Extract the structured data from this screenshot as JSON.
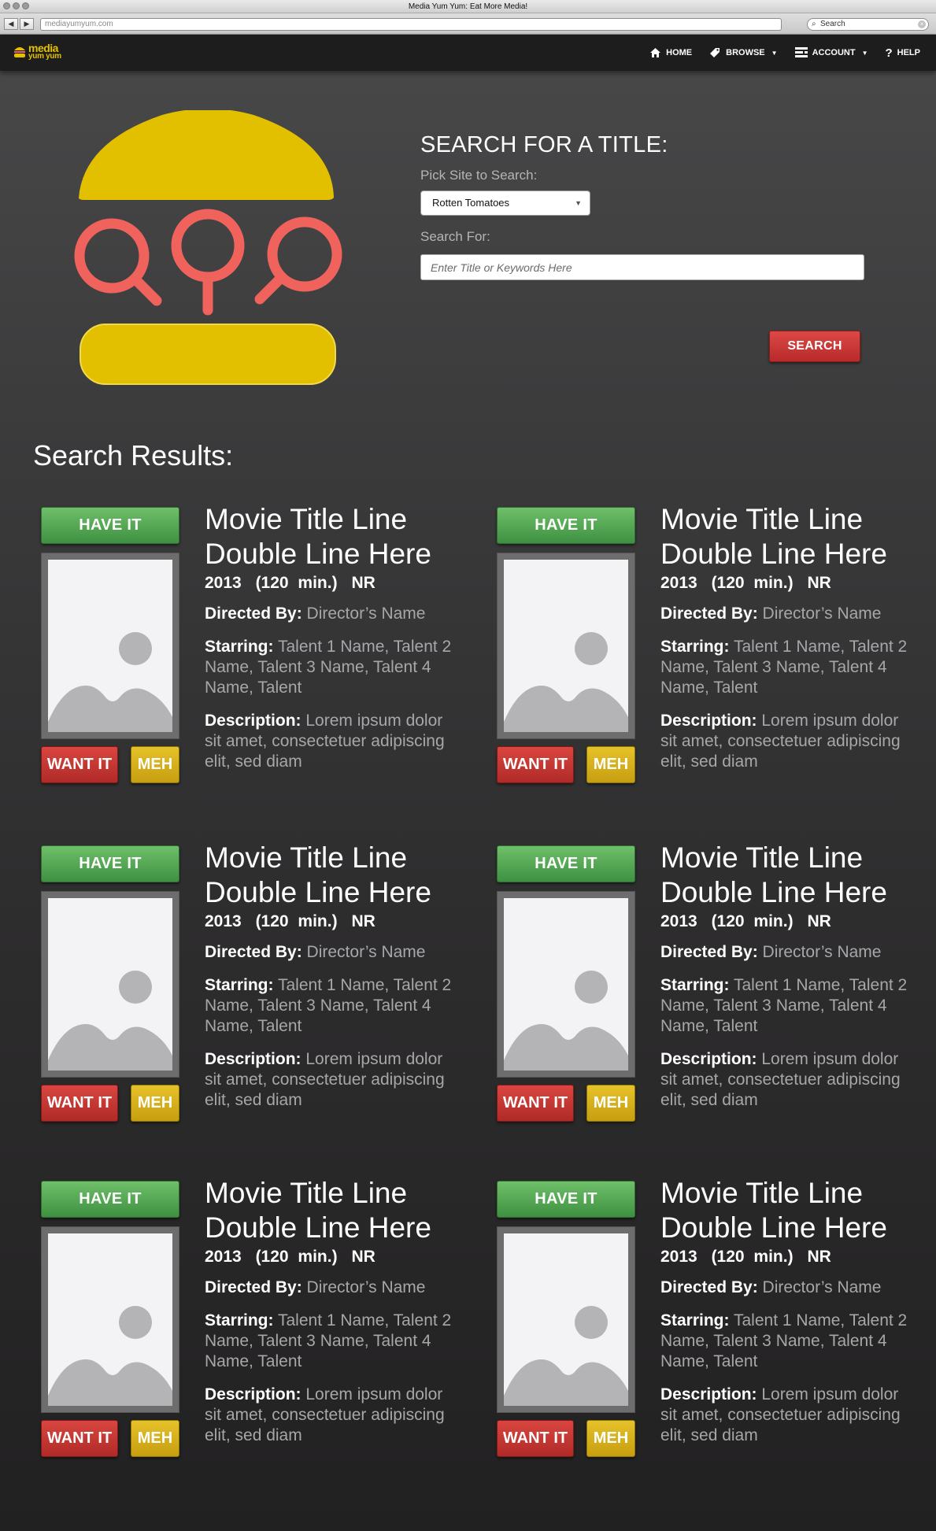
{
  "browser": {
    "window_title": "Media Yum Yum: Eat More Media!",
    "url": "mediayumyum.com",
    "search_placeholder": "Search",
    "back_glyph": "◀",
    "forward_glyph": "▶"
  },
  "brand": {
    "line1": "media",
    "line2": "yum yum",
    "color": "#e5c000"
  },
  "nav": {
    "home": "HOME",
    "browse": "BROWSE",
    "account": "ACCOUNT",
    "help": "HELP"
  },
  "search": {
    "title": "SEARCH FOR A TITLE:",
    "site_label": "Pick Site to Search:",
    "site_selected": "Rotten Tomatoes",
    "query_label": "Search For:",
    "query_placeholder": "Enter Title or Keywords Here",
    "button": "SEARCH"
  },
  "results": {
    "heading": "Search Results:",
    "items": [
      {
        "have": "HAVE IT",
        "want": "WANT IT",
        "meh": "MEH",
        "title": "Movie Title Line Double Line Here",
        "year": "2013",
        "runtime": "(120 min.)",
        "rating": "NR",
        "directed_label": "Directed By:",
        "director": "Director’s Name",
        "starring_label": "Starring:",
        "starring": "Talent 1 Name, Talent 2 Name, Talent 3 Name, Talent 4 Name, Talent",
        "desc_label": "Description:",
        "description": "Lorem ipsum dolor sit amet, consectetuer adipiscing elit, sed diam"
      },
      {
        "have": "HAVE IT",
        "want": "WANT IT",
        "meh": "MEH",
        "title": "Movie Title Line Double Line Here",
        "year": "2013",
        "runtime": "(120 min.)",
        "rating": "NR",
        "directed_label": "Directed By:",
        "director": "Director’s Name",
        "starring_label": "Starring:",
        "starring": "Talent 1 Name, Talent 2 Name, Talent 3 Name, Talent 4 Name, Talent",
        "desc_label": "Description:",
        "description": "Lorem ipsum dolor sit amet, consectetuer adipiscing elit, sed diam"
      },
      {
        "have": "HAVE IT",
        "want": "WANT IT",
        "meh": "MEH",
        "title": "Movie Title Line Double Line Here",
        "year": "2013",
        "runtime": "(120 min.)",
        "rating": "NR",
        "directed_label": "Directed By:",
        "director": "Director’s Name",
        "starring_label": "Starring:",
        "starring": "Talent 1 Name, Talent 2 Name, Talent 3 Name, Talent 4 Name, Talent",
        "desc_label": "Description:",
        "description": "Lorem ipsum dolor sit amet, consectetuer adipiscing elit, sed diam"
      },
      {
        "have": "HAVE IT",
        "want": "WANT IT",
        "meh": "MEH",
        "title": "Movie Title Line Double Line Here",
        "year": "2013",
        "runtime": "(120 min.)",
        "rating": "NR",
        "directed_label": "Directed By:",
        "director": "Director’s Name",
        "starring_label": "Starring:",
        "starring": "Talent 1 Name, Talent 2 Name, Talent 3 Name, Talent 4 Name, Talent",
        "desc_label": "Description:",
        "description": "Lorem ipsum dolor sit amet, consectetuer adipiscing elit, sed diam"
      },
      {
        "have": "HAVE IT",
        "want": "WANT IT",
        "meh": "MEH",
        "title": "Movie Title Line Double Line Here",
        "year": "2013",
        "runtime": "(120 min.)",
        "rating": "NR",
        "directed_label": "Directed By:",
        "director": "Director’s Name",
        "starring_label": "Starring:",
        "starring": "Talent 1 Name, Talent 2 Name, Talent 3 Name, Talent 4 Name, Talent",
        "desc_label": "Description:",
        "description": "Lorem ipsum dolor sit amet, consectetuer adipiscing elit, sed diam"
      },
      {
        "have": "HAVE IT",
        "want": "WANT IT",
        "meh": "MEH",
        "title": "Movie Title Line Double Line Here",
        "year": "2013",
        "runtime": "(120 min.)",
        "rating": "NR",
        "directed_label": "Directed By:",
        "director": "Director’s Name",
        "starring_label": "Starring:",
        "starring": "Talent 1 Name, Talent 2 Name, Talent 3 Name, Talent 4 Name, Talent",
        "desc_label": "Description:",
        "description": "Lorem ipsum dolor sit amet, consectetuer adipiscing elit, sed diam"
      }
    ]
  },
  "icons": {
    "home": "home-icon",
    "browse": "tag-icon",
    "account": "account-icon",
    "help": "help-icon",
    "poster": "image-placeholder-icon"
  },
  "colors": {
    "have": "#4fa74f",
    "want": "#c7352f",
    "meh": "#d6b018",
    "search_button": "#c7352f",
    "bun": "#e2c000",
    "magnifier": "#f0625c"
  }
}
